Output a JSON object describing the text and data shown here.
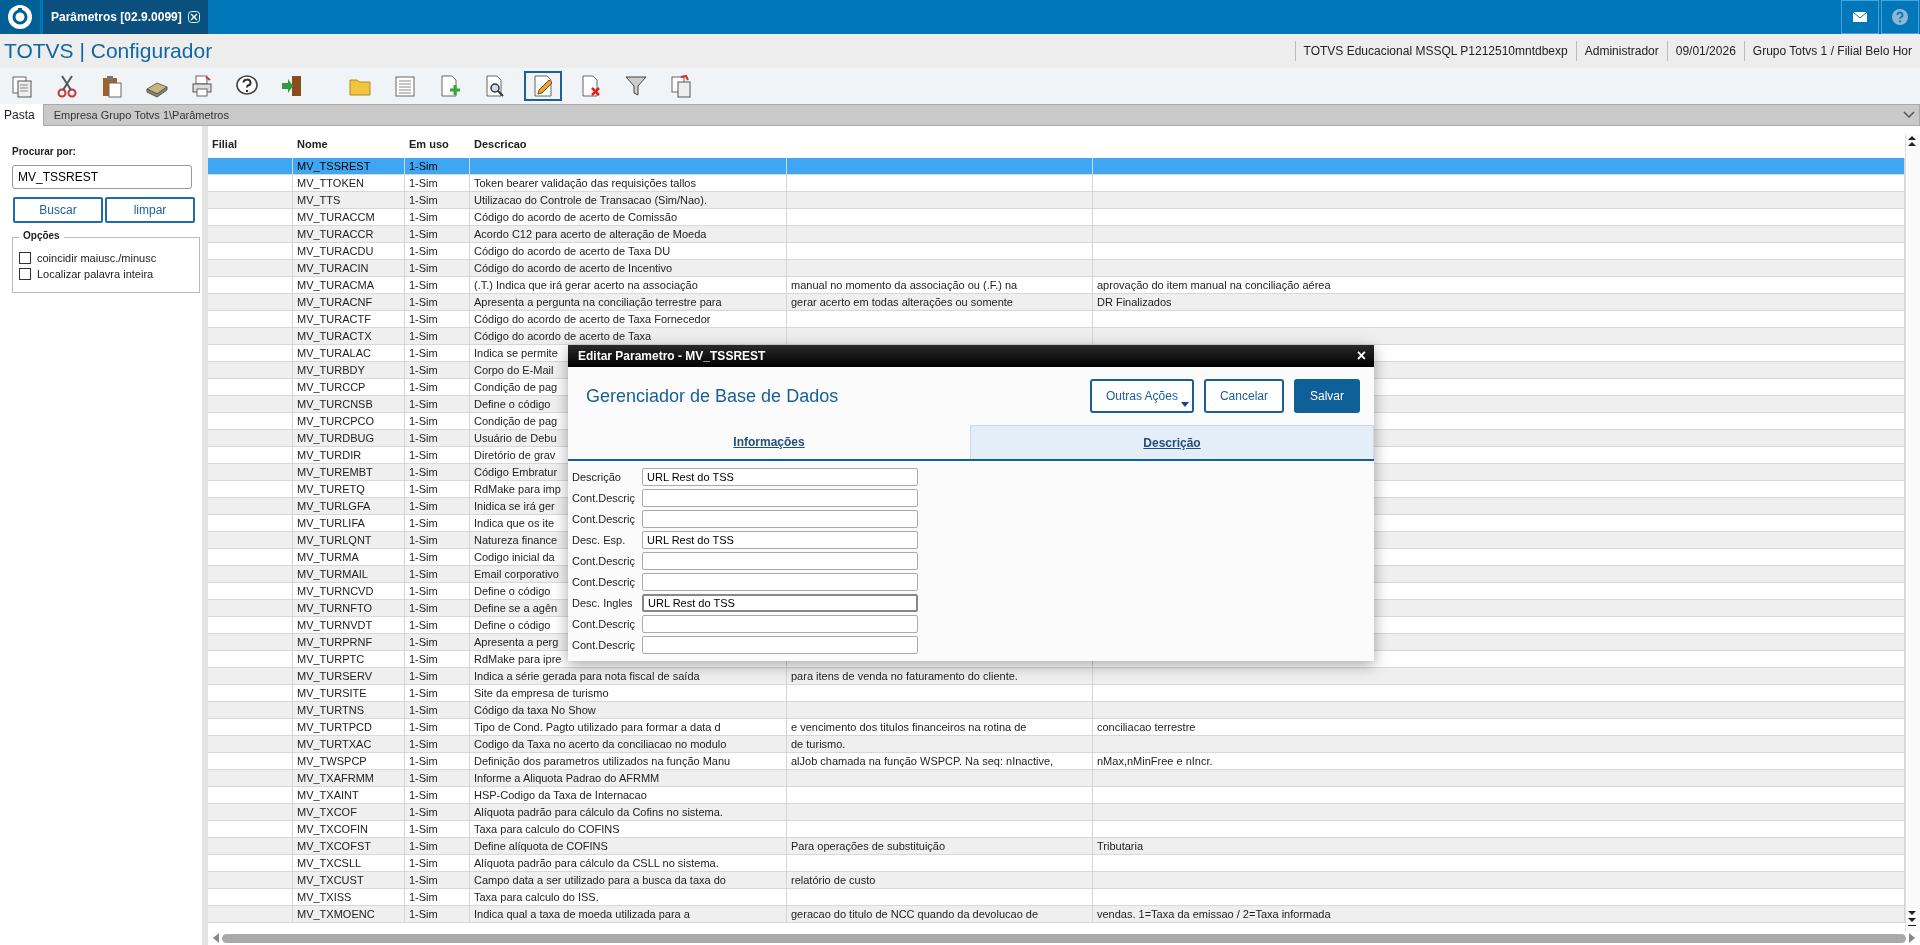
{
  "window": {
    "tab": "Parâmetros [02.9.0099]"
  },
  "header": {
    "title": "TOTVS | Configurador",
    "info": [
      "TOTVS Educacional MSSQL P1212510mntdbexp",
      "Administrador",
      "09/01/2026",
      "Grupo Totvs 1 / Filial Belo Hor"
    ]
  },
  "toolbar": [
    {
      "selected": false
    },
    {
      "selected": false
    },
    {
      "selected": false
    },
    {
      "selected": false
    },
    {
      "selected": false
    },
    {
      "selected": false
    },
    {
      "selected": false
    },
    {
      "selected": false
    },
    {
      "selected": false
    },
    {
      "selected": false
    },
    {
      "selected": false
    },
    {
      "selected": true
    },
    {
      "selected": false
    },
    {
      "selected": false
    },
    {
      "selected": false
    }
  ],
  "folder": {
    "label": "Pasta",
    "path": "Empresa Grupo Totvs 1\\Parâmetros"
  },
  "search": {
    "label": "Procurar por:",
    "value": "MV_TSSREST",
    "buttons": [
      "Buscar",
      "limpar"
    ],
    "options_title": "Opções",
    "options": [
      {
        "label": "coincidir maiusc./minusc",
        "checked": false
      },
      {
        "label": "Localizar palavra inteira",
        "checked": false
      }
    ]
  },
  "table": {
    "columns": [
      "Filial",
      "Nome",
      "Em uso",
      "Descricao"
    ],
    "rows": [
      {
        "nome": "MV_TSSREST",
        "em_uso": "1-Sim",
        "selected": true
      },
      {
        "nome": "MV_TTOKEN",
        "em_uso": "1-Sim",
        "descricao": "Token bearer validação das requisições tallos",
        "selected": false
      },
      {
        "nome": "MV_TTS",
        "em_uso": "1-Sim",
        "descricao": "Utilizacao do Controle de Transacao (Sim/Nao).",
        "selected": false
      },
      {
        "nome": "MV_TURACCM",
        "em_uso": "1-Sim",
        "descricao": "Código do acordo de acerto de Comissão",
        "selected": false
      },
      {
        "nome": "MV_TURACCR",
        "em_uso": "1-Sim",
        "descricao": "Acordo C12 para acerto de alteração de Moeda",
        "selected": false
      },
      {
        "nome": "MV_TURACDU",
        "em_uso": "1-Sim",
        "descricao": "Código do acordo de acerto de Taxa DU",
        "selected": false
      },
      {
        "nome": "MV_TURACIN",
        "em_uso": "1-Sim",
        "descricao": "Código do acordo de acerto de Incentivo",
        "selected": false
      },
      {
        "nome": "MV_TURACMA",
        "em_uso": "1-Sim",
        "descricao": "(.T.) Indica que irá gerar acerto na associação",
        "column_5": "manual no momento da associação ou (.F.) na",
        "column_6": "aprovação do item manual na conciliação aérea",
        "selected": false
      },
      {
        "nome": "MV_TURACNF",
        "em_uso": "1-Sim",
        "descricao": "Apresenta a pergunta na conciliação terrestre para",
        "column_5": "gerar acerto em todas alterações ou somente",
        "column_6": "DR Finalizados",
        "selected": false
      },
      {
        "nome": "MV_TURACTF",
        "em_uso": "1-Sim",
        "descricao": "Código do acordo de acerto de Taxa Fornecedor",
        "selected": false
      },
      {
        "nome": "MV_TURACTX",
        "em_uso": "1-Sim",
        "descricao": "Código do acordo de acerto de Taxa",
        "selected": false
      },
      {
        "nome": "MV_TURALAC",
        "em_uso": "1-Sim",
        "descricao": "Indica se permite",
        "selected": false
      },
      {
        "nome": "MV_TURBDY",
        "em_uso": "1-Sim",
        "descricao": "Corpo do E-Mail",
        "selected": false
      },
      {
        "nome": "MV_TURCCP",
        "em_uso": "1-Sim",
        "descricao": "Condição de pag",
        "selected": false
      },
      {
        "nome": "MV_TURCNSB",
        "em_uso": "1-Sim",
        "descricao": "Define o código",
        "selected": false
      },
      {
        "nome": "MV_TURCPCO",
        "em_uso": "1-Sim",
        "descricao": "Condição de pag",
        "selected": false
      },
      {
        "nome": "MV_TURDBUG",
        "em_uso": "1-Sim",
        "descricao": "Usuário de Debu",
        "selected": false
      },
      {
        "nome": "MV_TURDIR",
        "em_uso": "1-Sim",
        "descricao": "Diretório de grav",
        "selected": false
      },
      {
        "nome": "MV_TUREMBT",
        "em_uso": "1-Sim",
        "descricao": "Código Embratur",
        "selected": false
      },
      {
        "nome": "MV_TURETQ",
        "em_uso": "1-Sim",
        "descricao": "RdMake para imp",
        "selected": false
      },
      {
        "nome": "MV_TURLGFA",
        "em_uso": "1-Sim",
        "descricao": "Inidica se irá ger",
        "selected": false
      },
      {
        "nome": "MV_TURLIFA",
        "em_uso": "1-Sim",
        "descricao": "Indica que os ite",
        "selected": false
      },
      {
        "nome": "MV_TURLQNT",
        "em_uso": "1-Sim",
        "descricao": "Natureza finance",
        "selected": false
      },
      {
        "nome": "MV_TURMA",
        "em_uso": "1-Sim",
        "descricao": "Codigo inicial da",
        "selected": false
      },
      {
        "nome": "MV_TURMAIL",
        "em_uso": "1-Sim",
        "descricao": "Email corporativo",
        "selected": false
      },
      {
        "nome": "MV_TURNCVD",
        "em_uso": "1-Sim",
        "descricao": "Define o código",
        "selected": false
      },
      {
        "nome": "MV_TURNFTO",
        "em_uso": "1-Sim",
        "descricao": "Define se a agên",
        "selected": false
      },
      {
        "nome": "MV_TURNVDT",
        "em_uso": "1-Sim",
        "descricao": "Define o código",
        "selected": false
      },
      {
        "nome": "MV_TURPRNF",
        "em_uso": "1-Sim",
        "descricao": "Apresenta a perg",
        "selected": false
      },
      {
        "nome": "MV_TURPTC",
        "em_uso": "1-Sim",
        "descricao": "RdMake para ipre",
        "selected": false
      },
      {
        "nome": "MV_TURSERV",
        "em_uso": "1-Sim",
        "descricao": "Indica a série gerada para nota fiscal de saída",
        "column_5": "para itens de venda no faturamento do cliente.",
        "selected": false
      },
      {
        "nome": "MV_TURSITE",
        "em_uso": "1-Sim",
        "descricao": "Site da empresa de turismo",
        "selected": false
      },
      {
        "nome": "MV_TURTNS",
        "em_uso": "1-Sim",
        "descricao": "Código da taxa No Show",
        "selected": false
      },
      {
        "nome": "MV_TURTPCD",
        "em_uso": "1-Sim",
        "descricao": "Tipo de Cond. Pagto utilizado para formar a data d",
        "column_5": "e vencimento dos titulos financeiros na rotina de",
        "column_6": "conciliacao terrestre",
        "selected": false
      },
      {
        "nome": "MV_TURTXAC",
        "em_uso": "1-Sim",
        "descricao": "Codigo da Taxa no acerto da conciliacao no modulo",
        "column_5": "de turismo.",
        "selected": false
      },
      {
        "nome": "MV_TWSPCP",
        "em_uso": "1-Sim",
        "descricao": "Definição dos parametros utilizados na função Manu",
        "column_5": "alJob chamada na função WSPCP. Na seq: nInactive,",
        "column_6": "nMax,nMinFree e nIncr.",
        "selected": false
      },
      {
        "nome": "MV_TXAFRMM",
        "em_uso": "1-Sim",
        "descricao": "Informe a Aliquota Padrao do AFRMM",
        "selected": false
      },
      {
        "nome": "MV_TXAINT",
        "em_uso": "1-Sim",
        "descricao": "HSP-Codigo da Taxa de Internacao",
        "selected": false
      },
      {
        "nome": "MV_TXCOF",
        "em_uso": "1-Sim",
        "descricao": "Alíquota padrão para cálculo da Cofins no sistema.",
        "selected": false
      },
      {
        "nome": "MV_TXCOFIN",
        "em_uso": "1-Sim",
        "descricao": "Taxa para calculo do COFINS",
        "selected": false
      },
      {
        "nome": "MV_TXCOFST",
        "em_uso": "1-Sim",
        "descricao": "Define alíquota de COFINS",
        "column_5": "Para operações de substituição",
        "column_6": "Tributaria",
        "selected": false
      },
      {
        "nome": "MV_TXCSLL",
        "em_uso": "1-Sim",
        "descricao": "Alíquota padrão para cálculo da CSLL no sistema.",
        "selected": false
      },
      {
        "nome": "MV_TXCUST",
        "em_uso": "1-Sim",
        "descricao": "Campo data a ser utilizado para a busca da taxa do",
        "column_5": "relatório de custo",
        "selected": false
      },
      {
        "nome": "MV_TXISS",
        "em_uso": "1-Sim",
        "descricao": "Taxa para calculo do ISS.",
        "selected": false
      },
      {
        "nome": "MV_TXMOENC",
        "em_uso": "1-Sim",
        "descricao": "Indica qual a taxa de moeda utilizada para a",
        "column_5": "geracao do titulo de NCC quando da devolucao de",
        "column_6": "vendas. 1=Taxa da emissao / 2=Taxa informada",
        "selected": false
      }
    ]
  },
  "dialog": {
    "title": "Editar Parametro - MV_TSSREST",
    "close": "×",
    "heading": "Gerenciador de Base de Dados",
    "buttons": [
      {
        "label": "Outras Ações",
        "kind": "menu"
      },
      {
        "label": "Cancelar",
        "kind": "secondary"
      },
      {
        "label": "Salvar",
        "kind": "primary"
      }
    ],
    "tabs": [
      {
        "label": "Informações",
        "selected": false
      },
      {
        "label": "Descrição",
        "selected": true
      }
    ],
    "fields": [
      {
        "label": "Descrição",
        "value": "URL Rest do TSS",
        "focused": false
      },
      {
        "label": "Cont.Descriç",
        "focused": false
      },
      {
        "label": "Cont.Descriç",
        "focused": false
      },
      {
        "label": "Desc. Esp.",
        "value": "URL Rest do TSS",
        "focused": false
      },
      {
        "label": "Cont.Descriç",
        "focused": false
      },
      {
        "label": "Cont.Descriç",
        "focused": false
      },
      {
        "label": "Desc. Ingles",
        "value": "URL Rest do TSS",
        "focused": true
      },
      {
        "label": "Cont.Descriç",
        "focused": false
      },
      {
        "label": "Cont.Descriç",
        "focused": false
      }
    ]
  }
}
